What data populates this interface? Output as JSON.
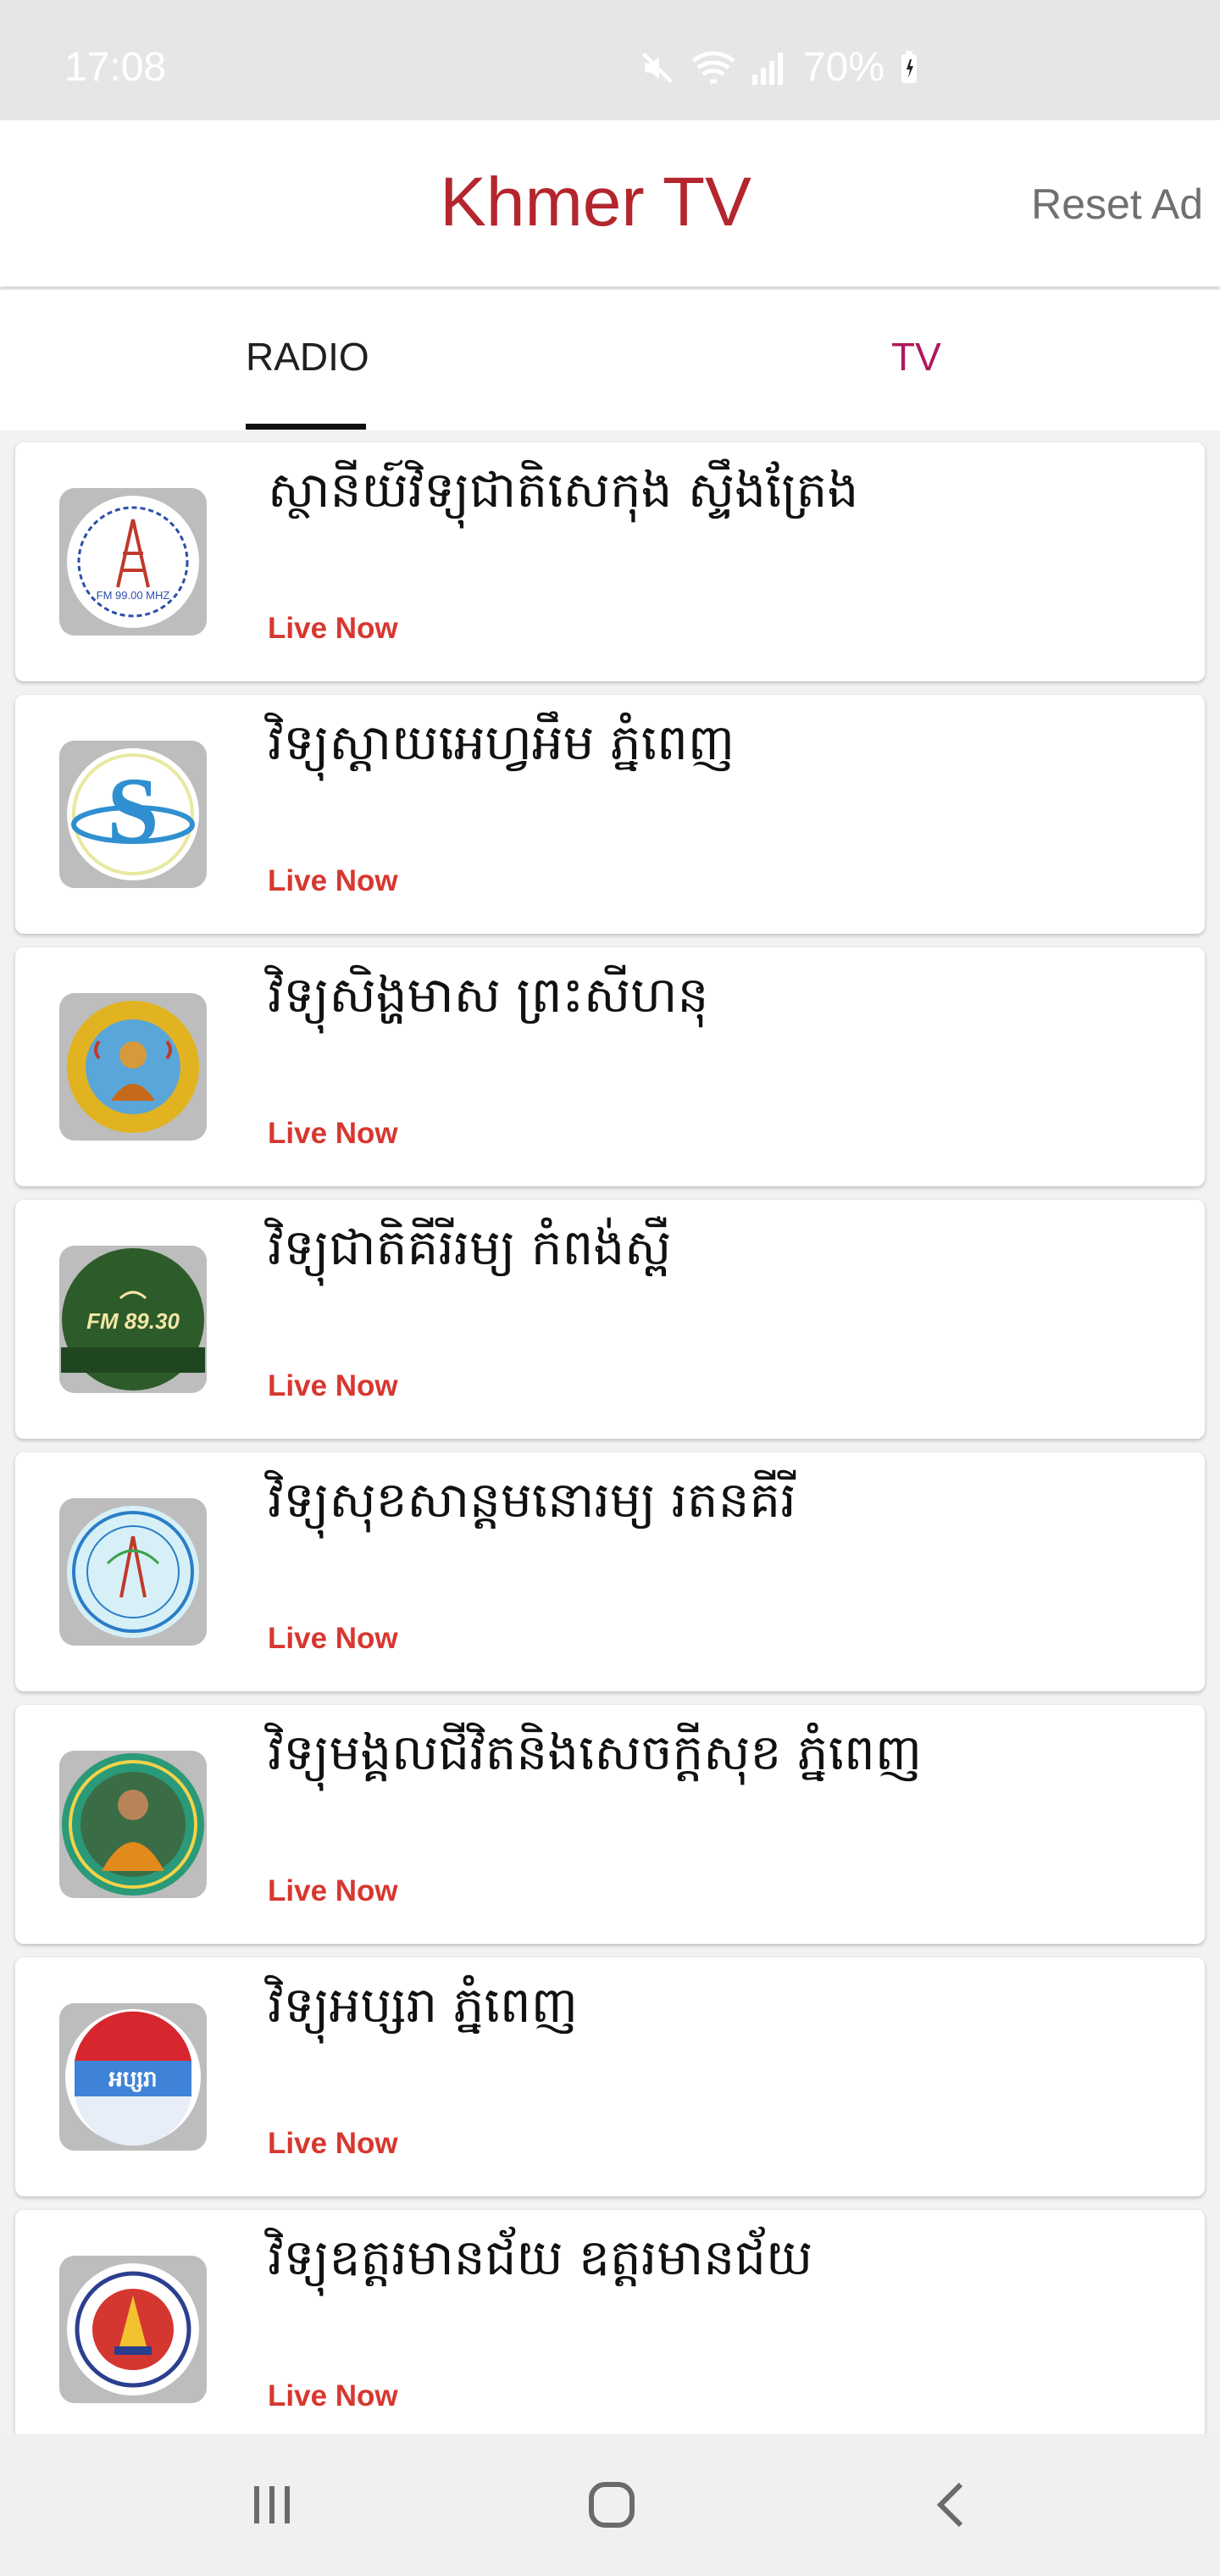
{
  "status_bar": {
    "time": "17:08",
    "battery": "70%"
  },
  "app_bar": {
    "title": "Khmer TV",
    "reset_ad": "Reset Ad"
  },
  "tabs": [
    {
      "label": "RADIO",
      "selected": true
    },
    {
      "label": "TV",
      "selected": false
    }
  ],
  "colors": {
    "accent": "#b3262d",
    "live": "#d7372f",
    "tv_tab": "#b0185a"
  },
  "stations": [
    {
      "name": "ស្ថានីយ៍វិទ្យុជាតិសេកុង ស្ទឹងត្រែង",
      "status": "Live Now",
      "logo_text": "FM 99.00 MHZ",
      "logo_icon": "radio-tower-icon"
    },
    {
      "name": "វិទ្យុស្តាយអេហ្វអឹម ភ្នំពេញ",
      "status": "Live Now",
      "logo_text": "",
      "logo_icon": "s-logo-icon"
    },
    {
      "name": "វិទ្យុសិង្ហមាស ព្រះសីហនុ",
      "status": "Live Now",
      "logo_text": "",
      "logo_icon": "monk-seal-icon"
    },
    {
      "name": "វិទ្យុជាតិគីរីរម្យ  កំពង់ស្ពឺ",
      "status": "Live Now",
      "logo_text": "FM 89.30",
      "logo_icon": "green-badge-icon"
    },
    {
      "name": "វិទ្យុសុខសាន្តមនោរម្យ  រតនគីរី",
      "status": "Live Now",
      "logo_text": "",
      "logo_icon": "antenna-seal-icon"
    },
    {
      "name": "វិទ្យុមង្គលជីវិតនិងសេចក្ដីសុខ ភ្នំពេញ",
      "status": "Live Now",
      "logo_text": "",
      "logo_icon": "monk-portrait-icon"
    },
    {
      "name": "វិទ្យុអប្សរា ភ្នំពេញ",
      "status": "Live Now",
      "logo_text": "អប្សរា",
      "logo_icon": "apsara-logo-icon"
    },
    {
      "name": "វិទ្យុឧត្តរមានជ័យ  ឧត្តរមានជ័យ",
      "status": "Live Now",
      "logo_text": "",
      "logo_icon": "temple-seal-icon"
    }
  ]
}
